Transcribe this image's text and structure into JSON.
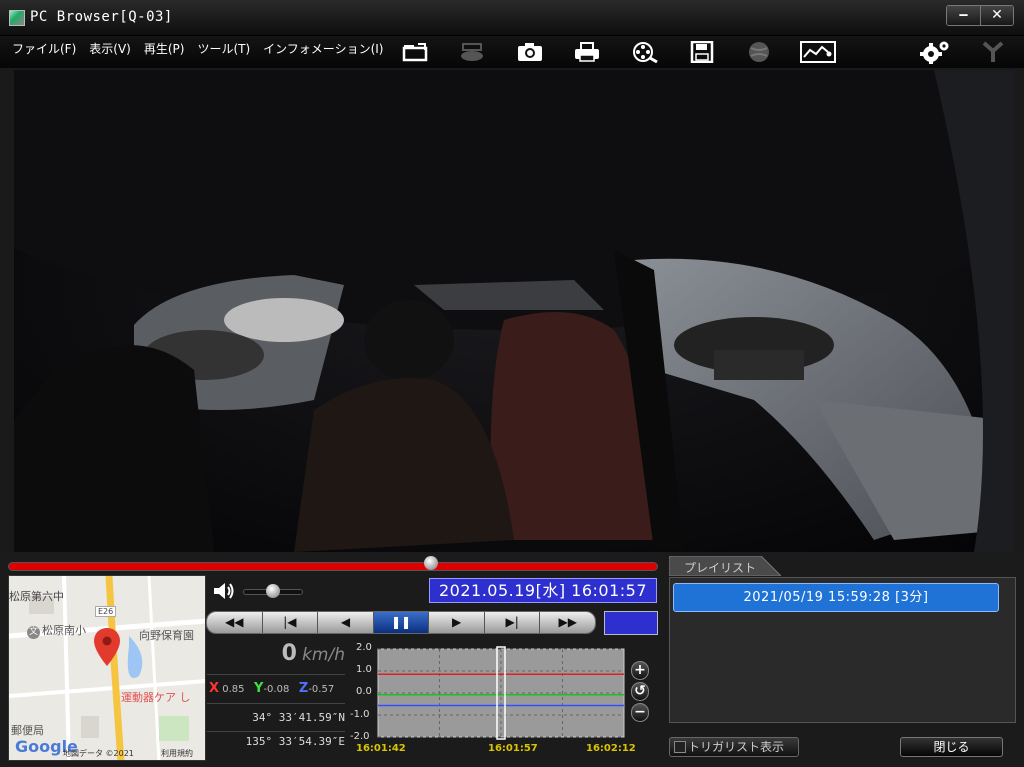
{
  "window": {
    "title": "PC Browser[Q-03]",
    "minimize_glyph": "‒",
    "close_glyph": "✕"
  },
  "menu": [
    {
      "label": "ファイル(F)"
    },
    {
      "label": "表示(V)"
    },
    {
      "label": "再生(P)"
    },
    {
      "label": "ツール(T)"
    },
    {
      "label": "インフォメーション(I)"
    }
  ],
  "toolbar": {
    "icons": [
      "open-folder-icon",
      "eject-icon",
      "camera-icon",
      "print-icon",
      "search-film-icon",
      "save-icon",
      "globe-icon",
      "graph-map-icon",
      "settings-icon",
      "disconnect-icon"
    ]
  },
  "playback": {
    "seek_fraction": 0.65,
    "volume_fraction": 0.5,
    "datetime": "2021.05.19[水] 16:01:57",
    "controls": [
      {
        "glyph": "◀◀",
        "name": "rewind-button"
      },
      {
        "glyph": "|◀",
        "name": "previous-button"
      },
      {
        "glyph": "◀",
        "name": "reverse-play-button"
      },
      {
        "glyph": "❚❚",
        "name": "pause-button",
        "active": true
      },
      {
        "glyph": "▶",
        "name": "play-button"
      },
      {
        "glyph": "▶|",
        "name": "next-button"
      },
      {
        "glyph": "▶▶",
        "name": "fast-forward-button"
      }
    ]
  },
  "telemetry": {
    "speed": "0",
    "speed_unit": "km/h",
    "x_label": "X",
    "x_value": "0.85",
    "y_label": "Y",
    "y_value": "-0.08",
    "z_label": "Z",
    "z_value": "-0.57",
    "latitude": "34° 33′41.59″N",
    "longitude": "135° 33′54.39″E"
  },
  "map": {
    "labels": {
      "top_left": "松原第六中",
      "road": "E26",
      "school": "松原南小",
      "nursery": "向野保育園",
      "shop": "運動器ケア し",
      "post": "郵便局",
      "google": "Google",
      "copyright": "地図データ ©2021",
      "terms": "利用規約"
    }
  },
  "graph": {
    "y_ticks": [
      "2.0",
      "1.0",
      "0.0",
      "-1.0",
      "-2.0"
    ],
    "x_ticks": [
      "16:01:42",
      "16:01:57",
      "16:02:12"
    ],
    "ylim": [
      -2.0,
      2.0
    ],
    "series": [
      {
        "color": "#e02020",
        "value": 0.85
      },
      {
        "color": "#20c020",
        "value": -0.08
      },
      {
        "color": "#3050ff",
        "value": -0.57
      }
    ],
    "zoom_in": "+",
    "reset": "↺",
    "zoom_out": "−"
  },
  "playlist": {
    "tab": "プレイリスト",
    "items": [
      "2021/05/19 15:59:28 [3分]"
    ],
    "trigger_label": "トリガリスト表示",
    "close_label": "閉じる"
  },
  "colors": {
    "seek": "#dd0000",
    "accent_blue": "#2e2fcf",
    "playlist_selected": "#1f72d6"
  }
}
